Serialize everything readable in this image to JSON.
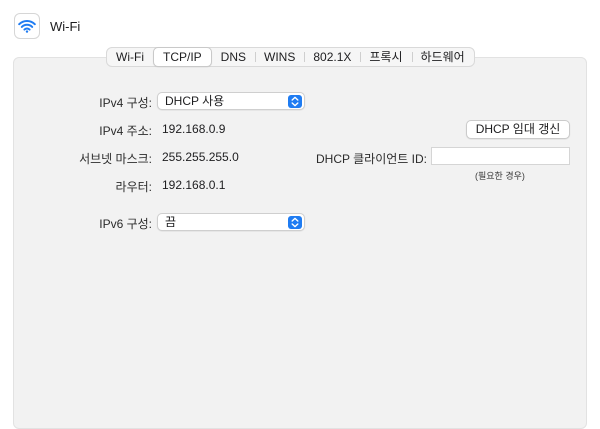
{
  "window": {
    "title": "Wi-Fi",
    "icon": "wifi-icon"
  },
  "tabs": [
    {
      "label": "Wi-Fi",
      "active": false
    },
    {
      "label": "TCP/IP",
      "active": true
    },
    {
      "label": "DNS",
      "active": false
    },
    {
      "label": "WINS",
      "active": false
    },
    {
      "label": "802.1X",
      "active": false
    },
    {
      "label": "프록시",
      "active": false
    },
    {
      "label": "하드웨어",
      "active": false
    }
  ],
  "tcpip": {
    "ipv4_config_label": "IPv4 구성:",
    "ipv4_config_value": "DHCP 사용",
    "ipv4_address_label": "IPv4 주소:",
    "ipv4_address_value": "192.168.0.9",
    "subnet_mask_label": "서브넷 마스크:",
    "subnet_mask_value": "255.255.255.0",
    "router_label": "라우터:",
    "router_value": "192.168.0.1",
    "renew_dhcp_button": "DHCP 임대 갱신",
    "dhcp_client_id_label": "DHCP 클라이언트 ID:",
    "dhcp_client_id_value": "",
    "dhcp_client_id_hint": "(필요한 경우)",
    "ipv6_config_label": "IPv6 구성:",
    "ipv6_config_value": "끔"
  },
  "colors": {
    "accent": "#1f7cf2",
    "panel_background": "#f2f2f2"
  }
}
